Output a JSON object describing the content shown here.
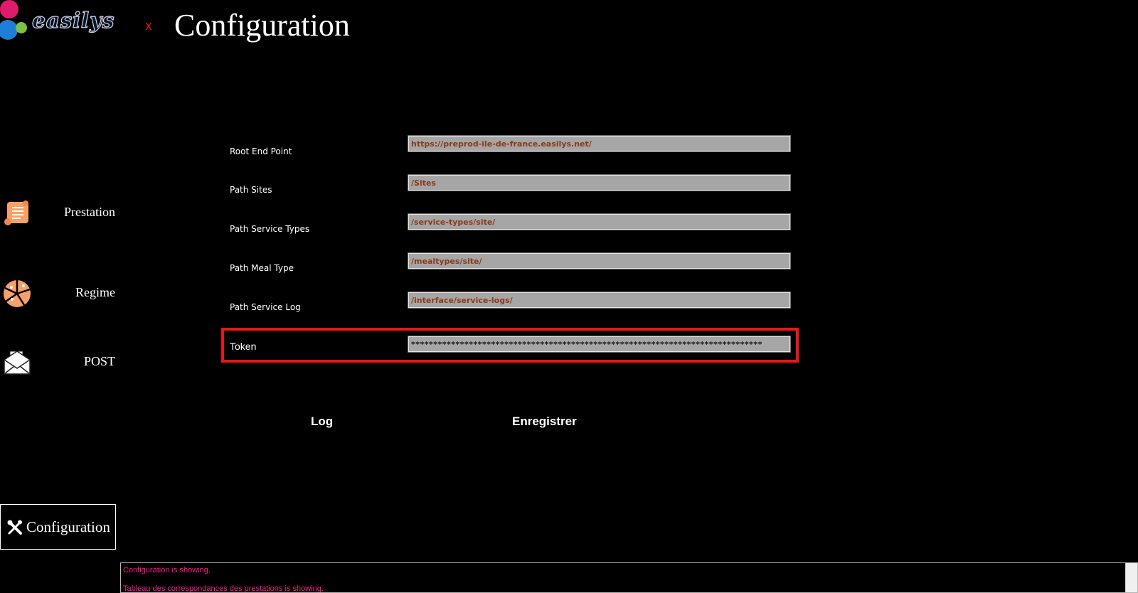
{
  "app": {
    "logo_text": "easilys",
    "close_label": "x",
    "title": "Configuration"
  },
  "sidebar": {
    "items": [
      {
        "label": "Prestation",
        "icon": "scroll-icon"
      },
      {
        "label": "Regime",
        "icon": "pie-chart-icon"
      },
      {
        "label": "POST",
        "icon": "envelope-icon"
      }
    ],
    "active": {
      "label": "Configuration",
      "icon": "tools-icon"
    }
  },
  "form": {
    "fields": [
      {
        "label": "Root End Point",
        "value": "https://preprod-ile-de-france.easilys.net/"
      },
      {
        "label": "Path Sites",
        "value": "/Sites"
      },
      {
        "label": "Path Service Types",
        "value": "/service-types/site/"
      },
      {
        "label": "Path Meal Type",
        "value": "/mealtypes/site/"
      },
      {
        "label": "Path Service Log",
        "value": "/interface/service-logs/"
      }
    ],
    "token": {
      "label": "Token",
      "value": "*******************************************************************************"
    }
  },
  "actions": {
    "log_label": "Log",
    "save_label": "Enregistrer"
  },
  "status": {
    "lines": [
      "Configuration is showing.",
      "Tableau des correspondances des prestations is showing."
    ]
  },
  "colors": {
    "background": "#000000",
    "text": "#ffffff",
    "close": "#e8161c",
    "highlight": "#e8161c",
    "input_bg": "#a6a6a6",
    "input_text": "#8b3a14",
    "status_text": "#ff1a8c",
    "icon_orange": "#f7a06a"
  }
}
